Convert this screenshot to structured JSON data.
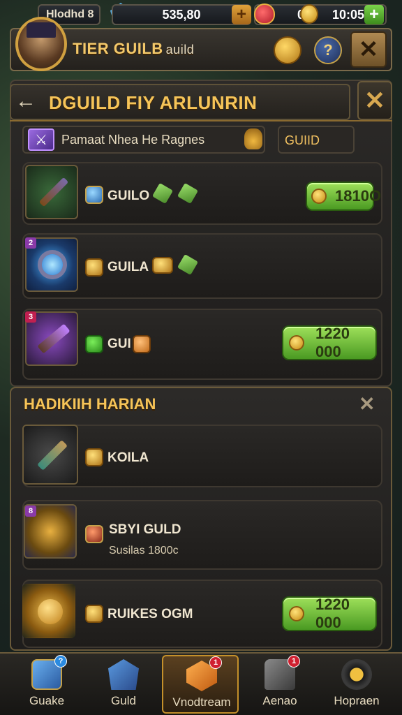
{
  "topbar": {
    "player_name": "Hlodhd 8",
    "gems": "535,80",
    "hearts": "0",
    "gold": "10:05",
    "plus": "+"
  },
  "header": {
    "title": "TIER GUILB",
    "subtitle": "auild",
    "info_glyph": "?",
    "close_glyph": "✕"
  },
  "panel": {
    "title": "DGUILD FIY ARLUNRIN",
    "back_glyph": "←",
    "close_glyph": "✕",
    "search_text": "Pamaat Nhea He Ragnes",
    "guild_pill": "GUIID"
  },
  "rows": [
    {
      "label": "GUILO",
      "price": "1810O"
    },
    {
      "label": "GUILA"
    },
    {
      "label": "GUI",
      "price": "1220 000"
    }
  ],
  "panel2": {
    "title": "HADIKIIH HARIAN",
    "close_glyph": "✕",
    "rows": [
      {
        "label": "KOILA"
      },
      {
        "label": "SBYI GULD",
        "sub": "Susilas 1800c"
      },
      {
        "label": "RUIKES OGM",
        "price": "1220 000"
      }
    ]
  },
  "nav": [
    {
      "label": "Guake",
      "badge": "?"
    },
    {
      "label": "Guld"
    },
    {
      "label": "Vnodtream",
      "badge": "1"
    },
    {
      "label": "Aenao",
      "badge": "1"
    },
    {
      "label": "Hopraen"
    }
  ]
}
